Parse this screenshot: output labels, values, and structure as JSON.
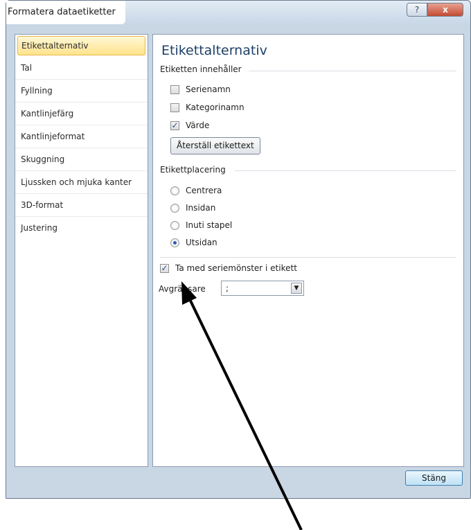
{
  "window": {
    "title": "Formatera dataetiketter",
    "help_glyph": "?",
    "close_glyph": "x"
  },
  "sidebar": {
    "items": [
      {
        "label": "Etikettalternativ",
        "selected": true
      },
      {
        "label": "Tal"
      },
      {
        "label": "Fyllning"
      },
      {
        "label": "Kantlinjefärg"
      },
      {
        "label": "Kantlinjeformat"
      },
      {
        "label": "Skuggning"
      },
      {
        "label": "Ljussken och mjuka kanter"
      },
      {
        "label": "3D-format"
      },
      {
        "label": "Justering"
      }
    ]
  },
  "panel": {
    "title": "Etikettalternativ",
    "contains_section": "Etiketten innehåller",
    "checkboxes": [
      {
        "label": "Serienamn",
        "checked": false
      },
      {
        "label": "Kategorinamn",
        "checked": false
      },
      {
        "label": "Värde",
        "checked": true
      }
    ],
    "reset_button": "Återställ etikettext",
    "placement_section": "Etikettplacering",
    "radios": [
      {
        "label": "Centrera",
        "selected": false
      },
      {
        "label": "Insidan",
        "selected": false
      },
      {
        "label": "Inuti stapel",
        "selected": false
      },
      {
        "label": "Utsidan",
        "selected": true
      }
    ],
    "legend_key": {
      "label": "Ta med seriemönster i etikett",
      "checked": true
    },
    "separator_label": "Avgränsare",
    "separator_value": ";"
  },
  "footer": {
    "close_button": "Stäng"
  },
  "colors": {
    "accent_selected": "#ffe38c",
    "heading": "#1d3f66",
    "check": "#2a4e9a"
  },
  "icons": {
    "check": "✓",
    "dropdown": "▼"
  }
}
